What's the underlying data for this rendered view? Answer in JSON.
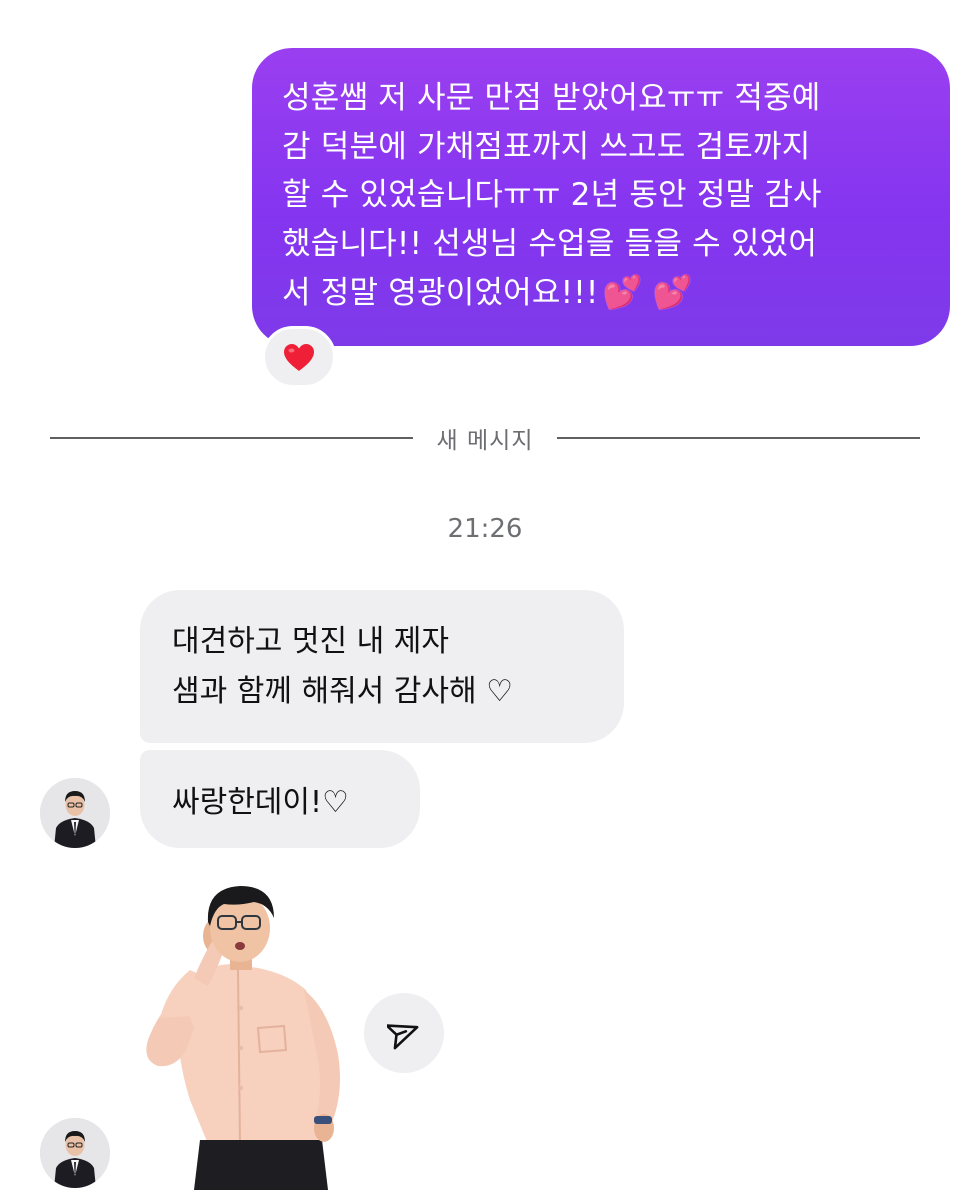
{
  "thread": {
    "sent_message": {
      "lines": [
        "성훈쌤 저 사문 만점 받았어요ㅠㅠ 적중예",
        "감 덕분에 가채점표까지 쓰고도 검토까지",
        "할 수 있었습니다ㅠㅠ 2년 동안 정말 감사",
        "했습니다!! 선생님 수업을 들을 수 있었어",
        "서 정말 영광이었어요!!!"
      ],
      "trailing_emoji": "💕 💕",
      "reaction_icon": "red-heart-icon"
    },
    "divider_label": "새 메시지",
    "timestamp": "21:26",
    "received_messages": [
      {
        "lines": [
          "대견하고 멋진 내 제자",
          "샘과 함께 해줘서 감사해 ♡"
        ]
      },
      {
        "lines": [
          "싸랑한데이!♡"
        ]
      }
    ],
    "sticker_icon": "teacher-sticker",
    "share_icon": "send-icon"
  },
  "colors": {
    "sent_bubble": "#8a38f0",
    "received_bubble": "#efeff1",
    "reaction_heart": "#ee1f36",
    "pink_hearts": "#ff4fb5"
  }
}
